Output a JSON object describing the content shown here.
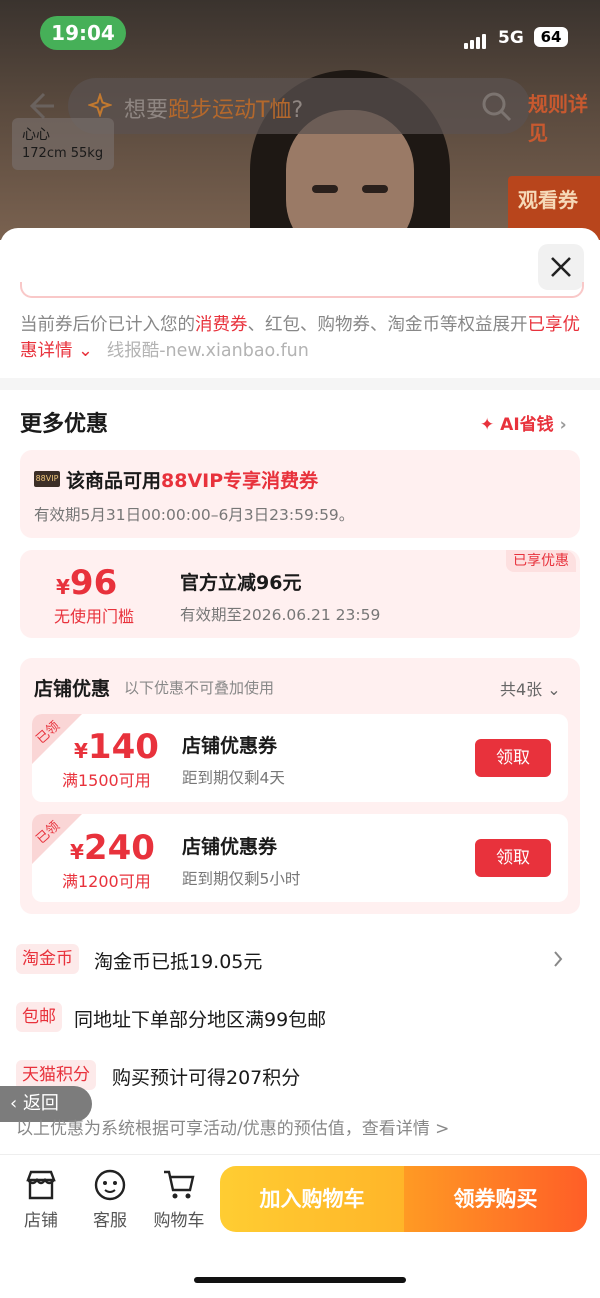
{
  "status_bar": {
    "time": "19:04",
    "network": "5G",
    "battery": "64"
  },
  "background_page": {
    "search_prefix": "想要",
    "search_highlight": "跑步运动T恤",
    "search_suffix": "?",
    "rule_tag": "规则详见",
    "model_name": "心心",
    "model_size": "172cm 55kg",
    "watch_tag": "观看券"
  },
  "notice": {
    "part1": "当前券后价已计入您的",
    "highlight1": "消费券",
    "part2": "、红包、购物券、淘金币等权益展开",
    "link": "已享优惠详情",
    "watermark": "线报酷-new.xianbao.fun"
  },
  "more_offers": {
    "title": "更多优惠",
    "ai_link": "AI省钱"
  },
  "vip_coupon": {
    "badge": "88VIP",
    "title_prefix": "该商品可用",
    "title_highlight": "88VIP专享消费券",
    "validity": "有效期5月31日00:00:00–6月3日23:59:59。"
  },
  "official_discount": {
    "currency": "¥",
    "amount": "96",
    "condition": "无使用门槛",
    "title": "官方立减96元",
    "validity": "有效期至2026.06.21 23:59",
    "status": "已享优惠"
  },
  "store_offers": {
    "title": "店铺优惠",
    "note": "以下优惠不可叠加使用",
    "count": "共4张",
    "coupons": [
      {
        "ribbon": "已领",
        "currency": "¥",
        "amount": "140",
        "condition": "满1500可用",
        "title": "店铺优惠券",
        "expiry": "距到期仅剩4天",
        "button": "领取"
      },
      {
        "ribbon": "已领",
        "currency": "¥",
        "amount": "240",
        "condition": "满1200可用",
        "title": "店铺优惠券",
        "expiry": "距到期仅剩5小时",
        "button": "领取"
      }
    ]
  },
  "rows": [
    {
      "tag": "淘金币",
      "text": "淘金币已抵19.05元"
    },
    {
      "tag": "包邮",
      "text": "同地址下单部分地区满99包邮"
    },
    {
      "tag": "天猫积分",
      "text": "购买预计可得207积分"
    }
  ],
  "back_pill": "返回",
  "estimate_note": "以上优惠为系统根据可享活动/优惠的预估值，查看详情 >",
  "bottom_bar": {
    "store": "店铺",
    "service": "客服",
    "cart": "购物车",
    "add_to_cart": "加入购物车",
    "claim_and_buy": "领券购买"
  },
  "colors": {
    "accent": "#e8323c",
    "cart_button": "#ffc12f",
    "buy_button": "#ff6a27"
  }
}
